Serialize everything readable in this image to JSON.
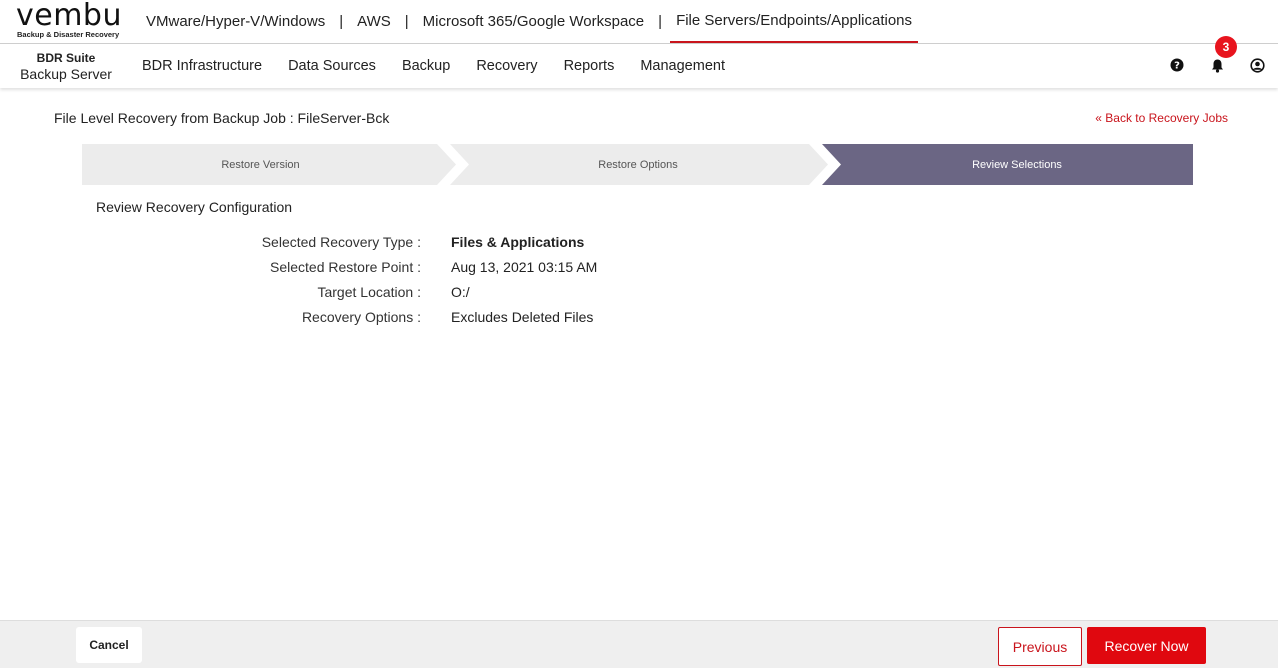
{
  "brand": {
    "logo_text": "vembu",
    "tagline": "Backup & Disaster Recovery",
    "accent": "#c9141c"
  },
  "product_nav": {
    "items": [
      {
        "label": "VMware/Hyper-V/Windows"
      },
      {
        "label": "AWS"
      },
      {
        "label": "Microsoft 365/Google Workspace"
      },
      {
        "label": "File Servers/Endpoints/Applications",
        "active": true
      }
    ],
    "separator": "|"
  },
  "suite": {
    "line1": "BDR Suite",
    "line2": "Backup Server"
  },
  "main_menu": [
    "BDR Infrastructure",
    "Data Sources",
    "Backup",
    "Recovery",
    "Reports",
    "Management"
  ],
  "header_icons": {
    "help": "help-icon",
    "notifications": "bell-icon",
    "notification_count": "3",
    "user": "user-icon"
  },
  "page": {
    "title": "File Level Recovery from Backup Job : FileServer-Bck",
    "back_link": "« Back to Recovery Jobs"
  },
  "wizard": {
    "steps": [
      {
        "label": "Restore Version",
        "active": false
      },
      {
        "label": "Restore Options",
        "active": false
      },
      {
        "label": "Review Selections",
        "active": true
      }
    ],
    "active_color": "#6b6684",
    "inactive_color": "#ececec"
  },
  "review": {
    "section_title": "Review Recovery Configuration",
    "rows": [
      {
        "label": "Selected Recovery Type :",
        "value": "Files & Applications"
      },
      {
        "label": "Selected Restore Point :",
        "value": "Aug 13, 2021 03:15 AM"
      },
      {
        "label": "Target Location :",
        "value": "O:/"
      },
      {
        "label": "Recovery Options :",
        "value": "Excludes Deleted Files"
      }
    ]
  },
  "footer": {
    "cancel": "Cancel",
    "previous": "Previous",
    "recover": "Recover Now"
  }
}
